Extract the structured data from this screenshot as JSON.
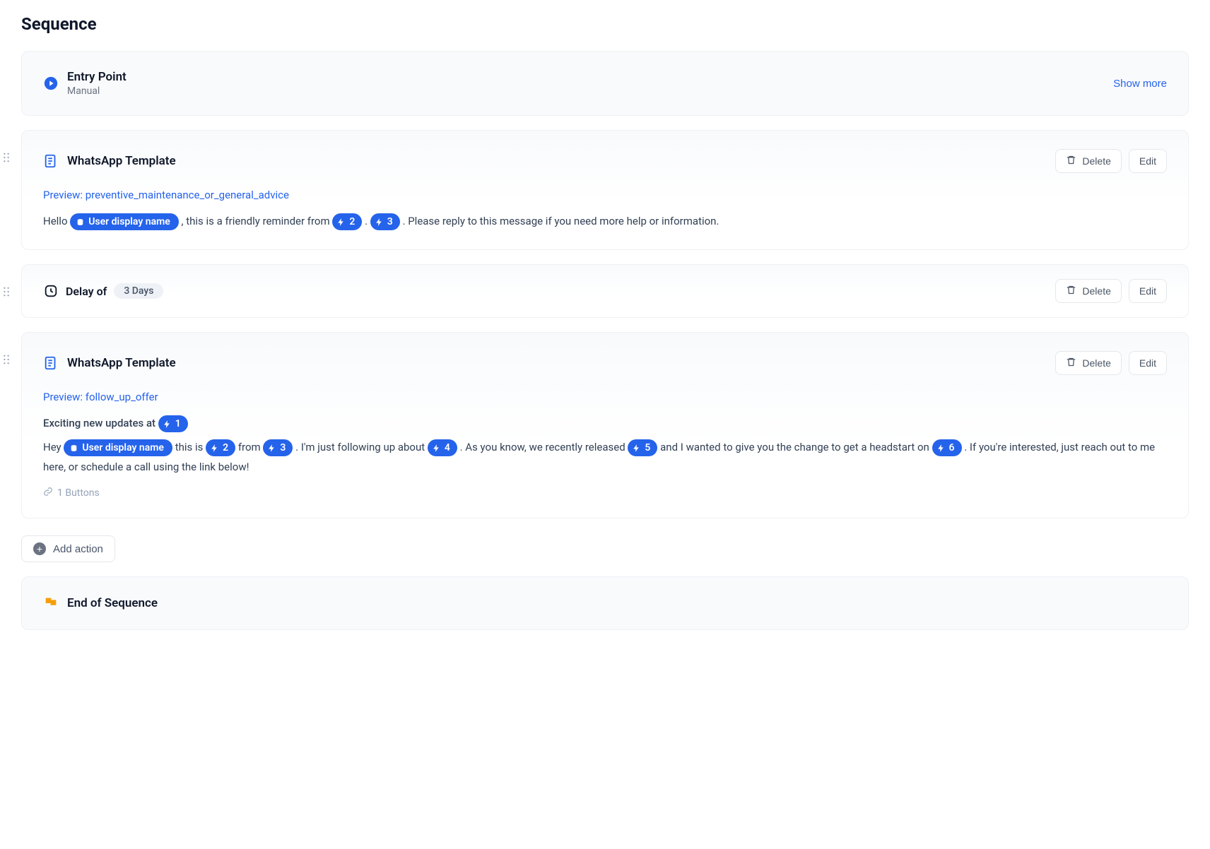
{
  "page_title": "Sequence",
  "entry": {
    "title": "Entry Point",
    "subtitle": "Manual",
    "show_more_label": "Show more"
  },
  "actions": {
    "delete_label": "Delete",
    "edit_label": "Edit",
    "add_action_label": "Add action"
  },
  "step1": {
    "title": "WhatsApp Template",
    "preview_label": "Preview: preventive_maintenance_or_general_advice",
    "body": {
      "hello": "Hello ",
      "user_pill": "User display name",
      "reminder_from": ", this is a friendly reminder from ",
      "pill2": "2",
      "dot": ". ",
      "pill3": "3",
      "rest": ". Please reply to this message if you need more help or information."
    }
  },
  "delay": {
    "label": "Delay of",
    "value": "3 Days"
  },
  "step2": {
    "title": "WhatsApp Template",
    "preview_label": "Preview: follow_up_offer",
    "header_line": {
      "prefix": "Exciting new updates at ",
      "pill1": "1"
    },
    "body": {
      "hey": "Hey ",
      "user_pill": "User display name",
      "this_is": " this is ",
      "pill2": "2",
      "from": " from ",
      "pill3": "3",
      "follow_up": ". I'm just following up about ",
      "pill4": "4",
      "released": ". As you know, we recently released ",
      "pill5": "5",
      "headstart": " and I wanted to give you the change to get a headstart on ",
      "pill6": "6",
      "rest": ". If you're interested, just reach out to me here, or schedule a call using the link below!"
    },
    "buttons_note": "1 Buttons"
  },
  "end": {
    "title": "End of Sequence"
  }
}
